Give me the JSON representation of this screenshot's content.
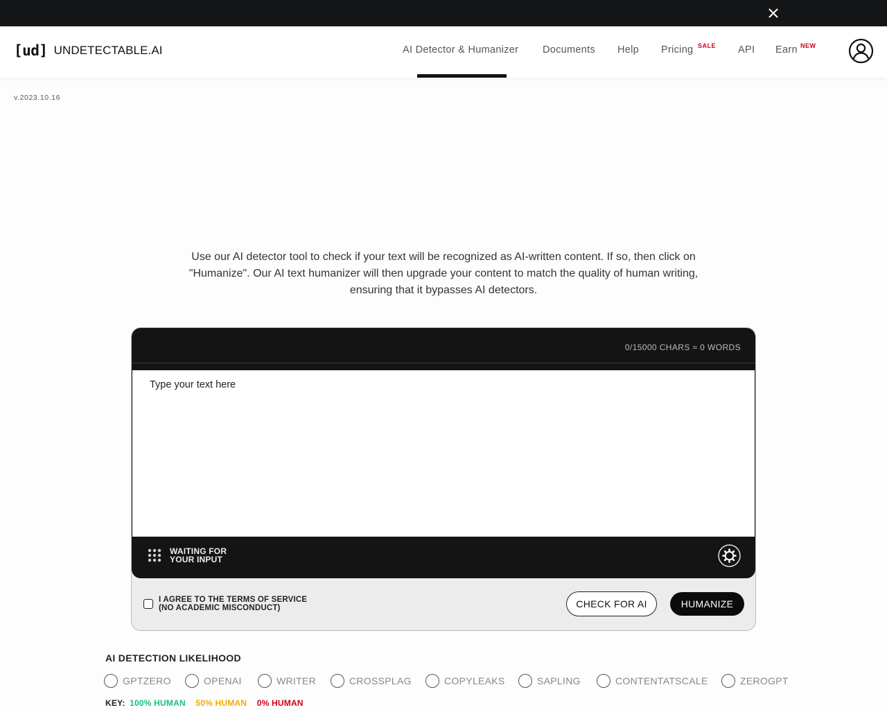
{
  "topbar": {
    "close_icon": "close-icon"
  },
  "brand": {
    "mark": "[ud]",
    "name": "UNDETECTABLE.AI"
  },
  "nav": {
    "items": [
      {
        "label": "AI Detector & Humanizer",
        "badge": ""
      },
      {
        "label": "Documents",
        "badge": ""
      },
      {
        "label": "Help",
        "badge": ""
      },
      {
        "label": "Pricing",
        "badge": "SALE"
      },
      {
        "label": "API",
        "badge": ""
      },
      {
        "label": "Earn",
        "badge": "NEW"
      }
    ],
    "active": "AI Detector & Humanizer",
    "badge_color": "#d0021b"
  },
  "version": "v.2023.10.16",
  "intro": "Use our AI detector tool to check if your text will be recognized as AI-written content. If so, then click on \"Humanize\". Our AI text humanizer will then upgrade your content to match the quality of human writing, ensuring that it bypasses AI detectors.",
  "editor": {
    "counter": "0/15000 CHARS ≈ 0 WORDS",
    "placeholder": "Type your text here",
    "value": "",
    "status_line1": "WAITING FOR",
    "status_line2": "YOUR INPUT"
  },
  "terms": {
    "line1": "I AGREE TO THE TERMS OF SERVICE",
    "line2": "(NO ACADEMIC MISCONDUCT)",
    "checked": false
  },
  "buttons": {
    "check": "CHECK FOR AI",
    "humanize": "HUMANIZE"
  },
  "detection": {
    "title": "AI DETECTION LIKELIHOOD",
    "detectors": [
      "GPTZERO",
      "OPENAI",
      "WRITER",
      "CROSSPLAG",
      "COPYLEAKS",
      "SAPLING",
      "CONTENTATSCALE",
      "ZEROGPT"
    ],
    "key_label": "KEY:",
    "key": [
      {
        "label": "100% HUMAN",
        "color": "#1dc07a"
      },
      {
        "label": "50% HUMAN",
        "color": "#f0ad00"
      },
      {
        "label": "0% HUMAN",
        "color": "#d0021b"
      }
    ]
  }
}
